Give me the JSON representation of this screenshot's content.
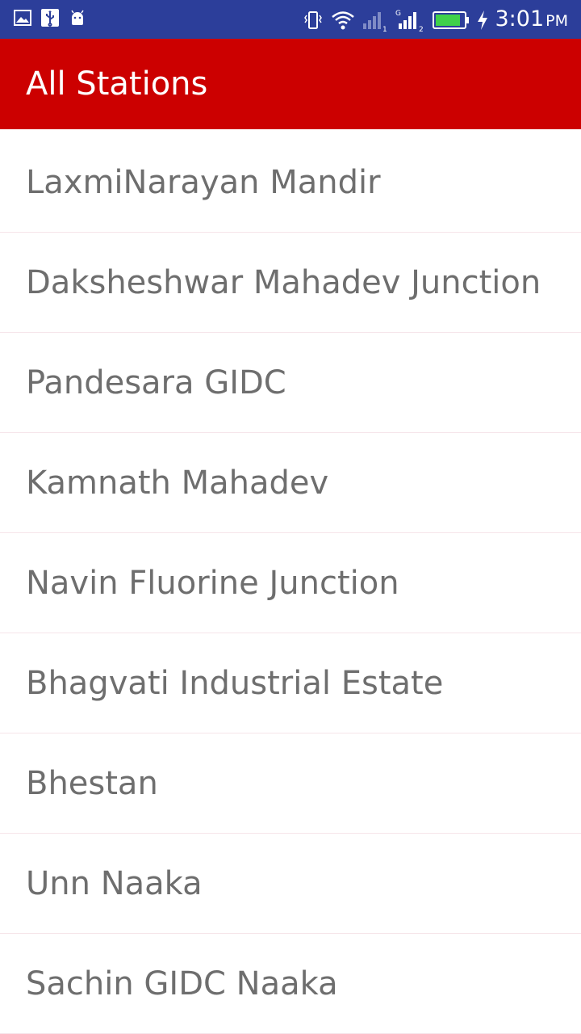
{
  "status_bar": {
    "time": "3:01",
    "ampm": "PM",
    "left_icons": [
      "image-icon",
      "usb-icon",
      "android-icon"
    ],
    "right_icons": [
      "vibrate-icon",
      "wifi-icon",
      "signal-sim1-icon",
      "signal-sim2-icon",
      "battery-icon",
      "charging-icon"
    ],
    "sim2_network_label": "G",
    "sim1_index": "1",
    "sim2_index": "2",
    "background_color": "#2c3e9a"
  },
  "app_bar": {
    "title": "All Stations",
    "background_color": "#cc0000"
  },
  "stations": [
    {
      "label": "LaxmiNarayan Mandir"
    },
    {
      "label": "Daksheshwar Mahadev Junction"
    },
    {
      "label": "Pandesara GIDC"
    },
    {
      "label": "Kamnath Mahadev"
    },
    {
      "label": "Navin Fluorine Junction"
    },
    {
      "label": "Bhagvati Industrial Estate"
    },
    {
      "label": "Bhestan"
    },
    {
      "label": "Unn Naaka"
    },
    {
      "label": "Sachin GIDC Naaka"
    }
  ]
}
